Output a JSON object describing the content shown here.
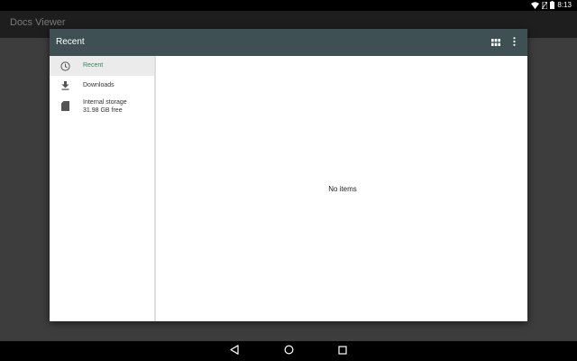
{
  "status_bar": {
    "time": "8:13",
    "icons": [
      "wifi-icon",
      "no-sim-icon",
      "battery-icon"
    ]
  },
  "app_bar": {
    "title": "Docs Viewer"
  },
  "dialog": {
    "title": "Recent",
    "toolbar_icons": [
      "grid-view-icon",
      "more-vert-icon"
    ],
    "drawer": {
      "items": [
        {
          "label": "Recent",
          "icon": "clock-icon",
          "selected": true
        },
        {
          "label": "Downloads",
          "icon": "download-icon",
          "selected": false
        },
        {
          "label": "Internal storage",
          "sublabel": "31.98 GB free",
          "icon": "sd-card-icon",
          "selected": false
        }
      ]
    },
    "content": {
      "empty_message": "No items"
    }
  },
  "nav_bar": {
    "icons": [
      "back-icon",
      "home-icon",
      "recents-icon"
    ]
  },
  "colors": {
    "toolbar": "#3f5054",
    "accent": "#2e8a5c",
    "selected_bg": "#ebebeb"
  }
}
